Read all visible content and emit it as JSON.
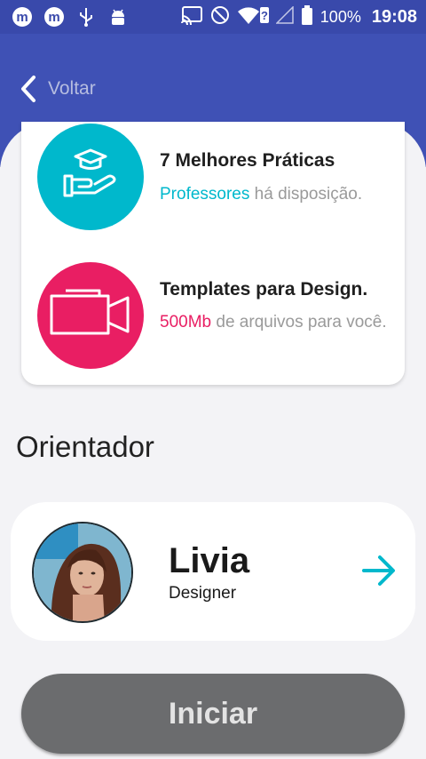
{
  "status_bar": {
    "battery": "100%",
    "time": "19:08",
    "icons_left": [
      "m-app-icon",
      "m-app-icon",
      "usb-icon",
      "android-icon"
    ],
    "icons_right": [
      "cast-icon",
      "do-not-disturb-icon",
      "wifi-question-icon",
      "signal-icon",
      "battery-icon"
    ]
  },
  "header": {
    "back_label": "Voltar"
  },
  "features": [
    {
      "title": "7 Melhores Práticas",
      "highlight": "Professores",
      "rest": " há disposição.",
      "icon": "graduation-hand-icon",
      "color": "#00b8cc"
    },
    {
      "title": "Templates para Design.",
      "highlight": "500Mb",
      "rest": " de arquivos para você.",
      "icon": "video-camera-icon",
      "color": "#e91e63"
    }
  ],
  "mentor_section": {
    "title": "Orientador"
  },
  "mentor": {
    "name": "Livia",
    "role": "Designer"
  },
  "actions": {
    "start_label": "Iniciar"
  }
}
